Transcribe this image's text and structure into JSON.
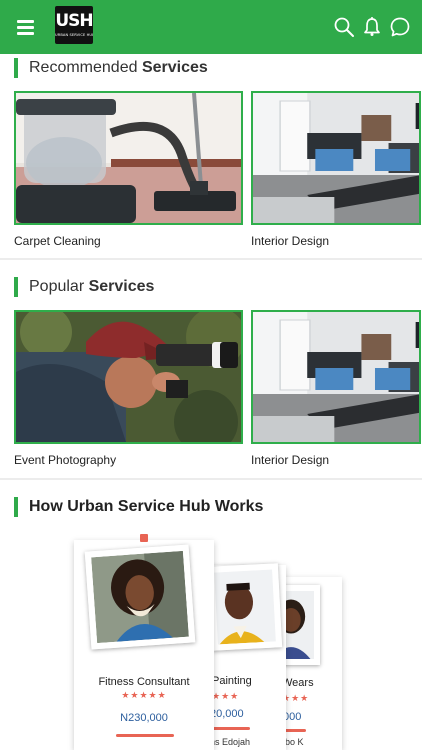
{
  "header": {
    "logo_text": "USH",
    "logo_subtext": "URBAN SERVICE HUB",
    "menu_icon": "hamburger-menu-icon",
    "icons": [
      "search-icon",
      "bell-icon",
      "chat-icon"
    ]
  },
  "recommended": {
    "title_light": "Recommended",
    "title_bold": "Services",
    "items": [
      {
        "label": "Carpet Cleaning",
        "image": "vacuum-cleaner"
      },
      {
        "label": "Interior Design",
        "image": "living-room"
      }
    ]
  },
  "popular": {
    "title_light": "Popular",
    "title_bold": "Services",
    "items": [
      {
        "label": "Event Photography",
        "image": "photographer-with-camera"
      },
      {
        "label": "Interior Design",
        "image": "living-room"
      }
    ]
  },
  "how_it_works": {
    "title": "How Urban Service Hub Works",
    "cards": [
      {
        "role": "Fitness Consultant",
        "stars": "★★★★★",
        "price": "N230,000"
      },
      {
        "role": "Painting",
        "stars": "★★★",
        "price": "20,000",
        "name": "ns Edojah"
      },
      {
        "role": "Wears",
        "stars": "★★★",
        "price": ",000",
        "name": "obo K"
      }
    ]
  },
  "colors": {
    "brand_green": "#2faa4a",
    "star_red": "#e86454",
    "price_blue": "#2d5f9e"
  }
}
